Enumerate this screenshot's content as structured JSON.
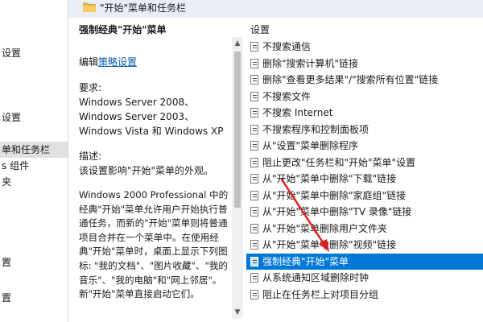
{
  "left_tree": {
    "items": [
      {
        "label": "设置",
        "selected": false
      },
      {
        "label": "设置",
        "selected": false
      },
      {
        "label": "单和任务栏",
        "selected": true
      },
      {
        "label": "s 组件",
        "selected": false
      },
      {
        "label": "夹",
        "selected": false
      },
      {
        "label": "置",
        "selected": false
      },
      {
        "label": "置",
        "selected": false
      }
    ]
  },
  "folder": {
    "title": "\"开始\"菜单和任务栏",
    "icon": "folder-icon"
  },
  "description": {
    "heading": "强制经典\"开始\"菜单",
    "edit_prefix": "编辑",
    "edit_link": "策略设置",
    "requirements_label": "要求:",
    "requirements": [
      "Windows Server 2008、",
      "Windows Server 2003、",
      "Windows Vista 和 Windows XP"
    ],
    "desc_label": "描述:",
    "desc_text": "该设置影响\"开始\"菜单的外观。",
    "long_desc": "Windows 2000 Professional 中的经典\"开始\"菜单允许用户开始执行普通任务，而新的\"开始\"菜单则将普通项目合并在一个菜单中。在使用经典\"开始\"菜单时，桌面上显示下列图标: \"我的文档\"、\"图片收藏\"、\"我的音乐\"、\"我的电脑\"和\"网上邻居\"。新\"开始\"菜单直接启动它们。"
  },
  "settings": {
    "header": "设置",
    "items": [
      {
        "label": "不搜索通信",
        "selected": false
      },
      {
        "label": "删除\"搜索计算机\"链接",
        "selected": false
      },
      {
        "label": "删除\"查看更多结果\"/\"搜索所有位置\"链接",
        "selected": false
      },
      {
        "label": "不搜索文件",
        "selected": false
      },
      {
        "label": "不搜索 Internet",
        "selected": false
      },
      {
        "label": "不搜索程序和控制面板项",
        "selected": false
      },
      {
        "label": "从\"设置\"菜单删除程序",
        "selected": false
      },
      {
        "label": "阻止更改\"任务栏和\"开始\"菜单\"设置",
        "selected": false
      },
      {
        "label": "从\"开始\"菜单中删除\"下载\"链接",
        "selected": false
      },
      {
        "label": "从\"开始\"菜单中删除\"家庭组\"链接",
        "selected": false
      },
      {
        "label": "从\"开始\"菜单中删除\"TV 录像\"链接",
        "selected": false
      },
      {
        "label": "从\"开始\"菜单删除用户文件夹",
        "selected": false
      },
      {
        "label": "从\"开始\"菜单中删除\"视频\"链接",
        "selected": false
      },
      {
        "label": "强制经典\"开始\"菜单",
        "selected": true
      },
      {
        "label": "从系统通知区域删除时钟",
        "selected": false
      },
      {
        "label": "阻止在任务栏上对项目分组",
        "selected": false
      }
    ]
  },
  "colors": {
    "selection": "#0078d7",
    "annotation_arrow": "#e02020",
    "title_band": "#e9eef6"
  }
}
